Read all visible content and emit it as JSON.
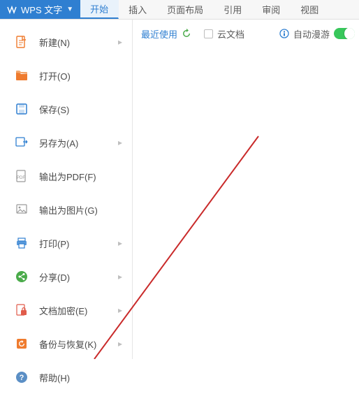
{
  "app": {
    "label": "WPS 文字"
  },
  "tabs": [
    {
      "label": "开始",
      "active": true
    },
    {
      "label": "插入"
    },
    {
      "label": "页面布局"
    },
    {
      "label": "引用"
    },
    {
      "label": "审阅"
    },
    {
      "label": "视图"
    }
  ],
  "header": {
    "recent_label": "最近使用",
    "cloud_doc_label": "云文档",
    "auto_roam_label": "自动漫游"
  },
  "menu": {
    "new": "新建(N)",
    "open": "打开(O)",
    "save": "保存(S)",
    "saveas": "另存为(A)",
    "exportpdf": "输出为PDF(F)",
    "exportimg": "输出为图片(G)",
    "print": "打印(P)",
    "share": "分享(D)",
    "encrypt": "文档加密(E)",
    "backup": "备份与恢复(K)",
    "help": "帮助(H)"
  },
  "colors": {
    "primary": "#2f7fd1",
    "orange": "#ef7b2e",
    "red": "#e05b4a",
    "green": "#4aab4a",
    "teal": "#3fb7a4",
    "gray": "#9a9a9a"
  }
}
